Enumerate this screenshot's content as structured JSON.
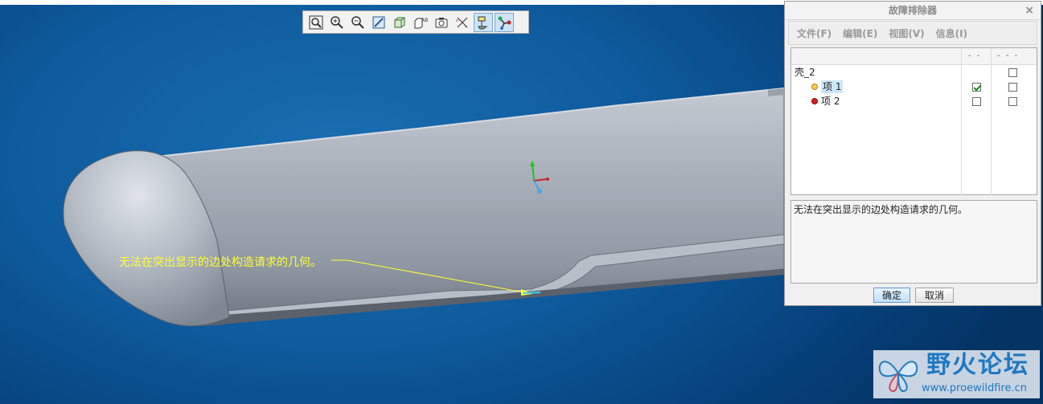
{
  "annotation": {
    "text": "无法在突出显示的边处构造请求的几何。"
  },
  "toolbar": {
    "buttons": [
      {
        "icon": "zoom-fit-icon"
      },
      {
        "icon": "zoom-in-icon"
      },
      {
        "icon": "zoom-out-icon"
      },
      {
        "icon": "repaint-icon"
      },
      {
        "icon": "display-style-icon"
      },
      {
        "icon": "saved-views-icon"
      },
      {
        "icon": "view-manager-icon"
      },
      {
        "icon": "datum-display-icon"
      },
      {
        "icon": "annotation-display-icon"
      },
      {
        "icon": "spin-center-icon"
      }
    ]
  },
  "dialog": {
    "title": "故障排除器",
    "close": "×",
    "menu": [
      "文件(F)",
      "编辑(E)",
      "视图(V)",
      "信息(I)"
    ],
    "columns": [
      "- -",
      "- - -"
    ],
    "tree": {
      "root": "壳_2",
      "items": [
        {
          "label": "项 1",
          "status": "warning",
          "check1": true,
          "check2": false,
          "selected": true
        },
        {
          "label": "项 2",
          "status": "error",
          "check1": false,
          "check2": false,
          "selected": false
        }
      ]
    },
    "message": "无法在突出显示的边处构造请求的几何。",
    "ok": "确定",
    "cancel": "取消"
  },
  "watermark": {
    "title": "野火论坛",
    "url": "www.proewildfire.cn"
  },
  "colors": {
    "background": "#0e5a9c",
    "annotation": "#ffff33",
    "accent": "#1f78c0"
  }
}
